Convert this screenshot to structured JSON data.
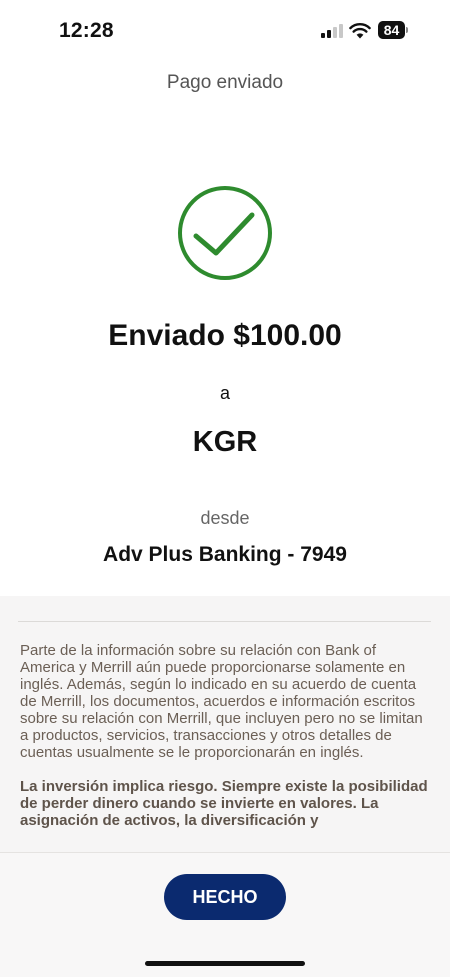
{
  "status_bar": {
    "time": "12:28",
    "battery_level": "84",
    "signal_bars_active": 2,
    "signal_bars_total": 4,
    "icons": [
      "signal-icon",
      "wifi-icon",
      "battery-icon"
    ]
  },
  "header": {
    "title": "Pago enviado"
  },
  "confirmation": {
    "icon": "check-circle-icon",
    "amount_text": "Enviado $100.00",
    "to_label": "a",
    "recipient": "KGR",
    "from_label": "desde",
    "account": "Adv Plus Banking - 7949"
  },
  "disclosure": {
    "paragraph_1": "Parte de la información sobre su relación con Bank of America y Merrill aún puede proporcionarse solamente en inglés. Además, según lo indicado en su acuerdo de cuenta de Merrill, los documentos, acuerdos e información escritos sobre su relación con Merrill, que incluyen pero no se limitan a productos, servicios, transacciones y otros detalles de cuentas usualmente se le proporcionarán en inglés.",
    "paragraph_2": "La inversión implica riesgo. Siempre existe la posibilidad de perder dinero cuando se invierte en valores. La asignación de activos, la diversificación y"
  },
  "actions": {
    "done_label": "HECHO"
  },
  "colors": {
    "check_green": "#2e8b2e",
    "button_navy": "#0b2a6f",
    "disclosure_text": "#6b5f55",
    "disclosure_bg": "#f6f5f5"
  }
}
